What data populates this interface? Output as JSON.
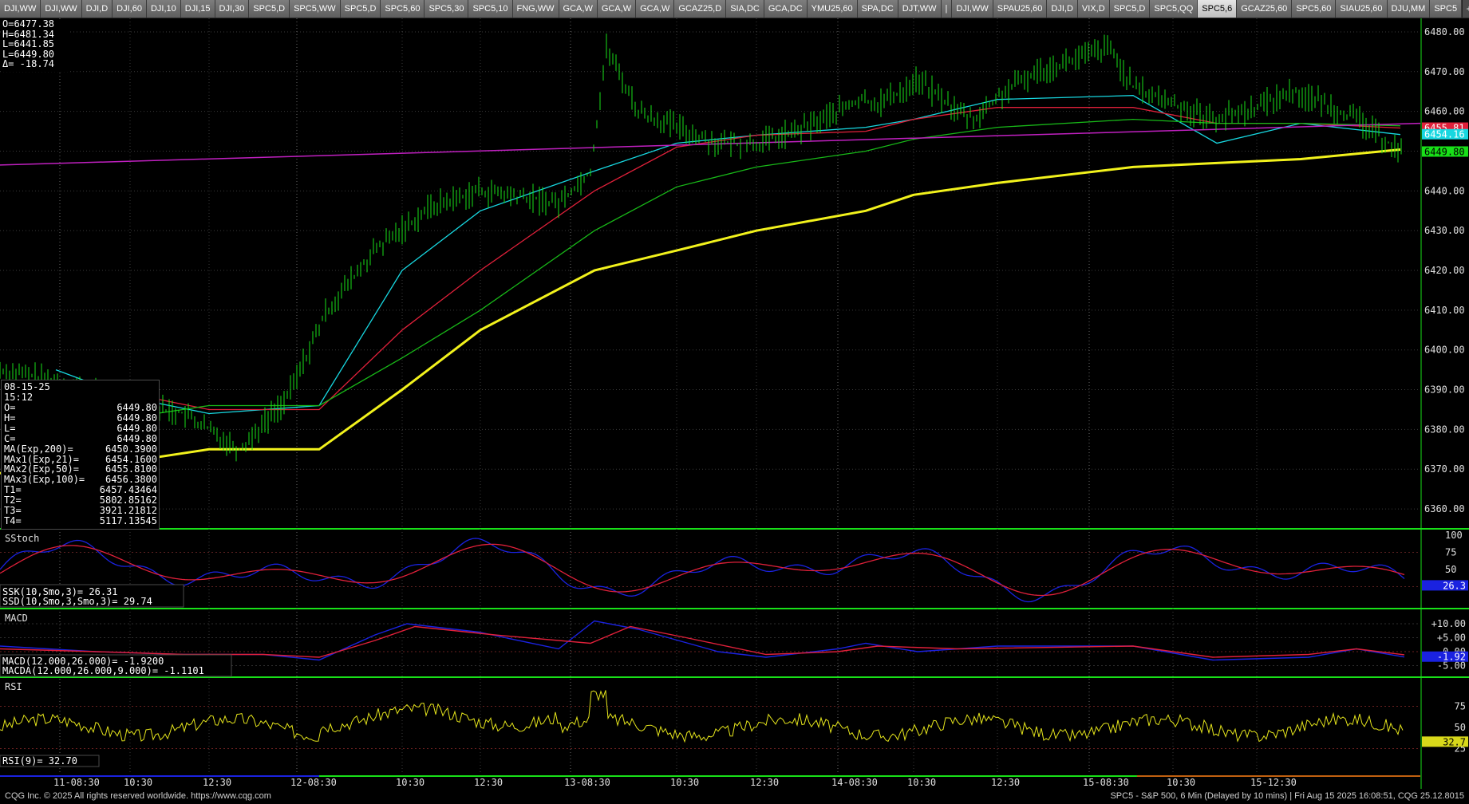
{
  "tabs": [
    "DJI,WW",
    "DJI,WW",
    "DJI,D",
    "DJI,60",
    "DJI,10",
    "DJI,15",
    "DJI,30",
    "SPC5,D",
    "SPC5,WW",
    "SPC5,D",
    "SPC5,60",
    "SPC5,30",
    "SPC5,10",
    "FNG,WW",
    "GCA,W",
    "GCA,W",
    "GCA,W",
    "GCAZ25,D",
    "SIA,DC",
    "GCA,DC",
    "YMU25,60",
    "SPA,DC",
    "DJT,WW",
    "|",
    "DJI,WW",
    "SPAU25,60",
    "DJI,D",
    "VIX,D",
    "SPC5,D",
    "SPC5,QQ",
    "SPC5,6",
    "GCAZ25,60",
    "SPC5,60",
    "SIAU25,60",
    "DJU,MM",
    "SPC5"
  ],
  "active_tab": "SPC5,6",
  "tab_buttons": {
    "add": "+",
    "scroll_left": "◂",
    "scroll_right": "▸"
  },
  "ohlc_box": {
    "lines": [
      "O=6477.38",
      "H=6481.34",
      "L=6441.85",
      "L=6449.80",
      "Δ= -18.74"
    ]
  },
  "data_window": {
    "date": "08-15-25",
    "time": "15:12",
    "rows": [
      {
        "label": "O=",
        "value": "6449.80"
      },
      {
        "label": "H=",
        "value": "6449.80"
      },
      {
        "label": "L=",
        "value": "6449.80"
      },
      {
        "label": "C=",
        "value": "6449.80"
      },
      {
        "label": "MA(Exp,200)=",
        "value": "6450.3900"
      },
      {
        "label": "MAx1(Exp,21)=",
        "value": "6454.1600"
      },
      {
        "label": "MAx2(Exp,50)=",
        "value": "6455.8100"
      },
      {
        "label": "MAx3(Exp,100)=",
        "value": "6456.3800"
      },
      {
        "label": "T1=",
        "value": "6457.43464"
      },
      {
        "label": "T2=",
        "value": "5802.85162"
      },
      {
        "label": "T3=",
        "value": "3921.21812"
      },
      {
        "label": "T4=",
        "value": "5117.13545"
      }
    ]
  },
  "price_axis": {
    "ticks": [
      "6480.00",
      "6470.00",
      "6460.00",
      "6450.00",
      "6440.00",
      "6430.00",
      "6420.00",
      "6410.00",
      "6400.00",
      "6390.00",
      "6380.00",
      "6370.00",
      "6360.00"
    ],
    "markers": [
      {
        "value": "6455.81",
        "color": "#e0203a"
      },
      {
        "value": "6454.16",
        "color": "#17d7e0"
      },
      {
        "value": "6449.80",
        "color": "#18e018"
      }
    ]
  },
  "stoch": {
    "title": "SStoch",
    "readouts": [
      "SSK(10,Smo,3)=        26.31",
      "SSD(10,Smo,3,Smo,3)=  29.74"
    ],
    "axis": [
      "100",
      "75",
      "50",
      "25"
    ],
    "marker": {
      "value": "26.3",
      "color": "#1a22e0"
    }
  },
  "macd": {
    "title": "MACD",
    "readouts": [
      "MACD(12.000,26.000)=       -1.9200",
      "MACDA(12.000,26.000,9.000)= -1.1101"
    ],
    "axis": [
      "+10.00",
      "+5.00",
      "0.00",
      "-5.00"
    ],
    "marker": {
      "value": "-1.92",
      "color": "#1a22e0"
    }
  },
  "rsi": {
    "title": "RSI",
    "readout": "RSI(9)=   32.70",
    "axis": [
      "75",
      "50",
      "25"
    ],
    "marker": {
      "value": "32.7",
      "color": "#d8d81a"
    }
  },
  "time_axis": [
    "11-08:30",
    "10:30",
    "12:30",
    "12-08:30",
    "10:30",
    "12:30",
    "13-08:30",
    "10:30",
    "12:30",
    "14-08:30",
    "10:30",
    "12:30",
    "15-08:30",
    "10:30",
    "15-12:30"
  ],
  "footer": {
    "left": "CQG Inc. © 2025 All rights reserved worldwide. https://www.cqg.com",
    "right": "SPC5 - S&P 500, 6 Min (Delayed by 10 mins) | Fri Aug 15 2025 16:08:51, CQG 25.12.8015"
  },
  "colors": {
    "price": "#19e019",
    "ema21": "#17d7e0",
    "ema50": "#e0203a",
    "ema100": "#18b818",
    "ema200": "#f2f21c",
    "trend": "#c020c0",
    "k": "#1a22e0",
    "d": "#e0203a",
    "rsi": "#e6e61c"
  },
  "chart_data": {
    "type": "line",
    "x": [
      "11-08:30",
      "11-10:30",
      "11-12:30",
      "12-08:30",
      "12-10:30",
      "12-12:30",
      "13-08:30",
      "13-10:30",
      "13-12:30",
      "14-08:30",
      "14-10:30",
      "14-12:30",
      "15-08:30",
      "15-10:30",
      "15-12:30",
      "15-15:12"
    ],
    "series": [
      {
        "name": "MA(Exp,200)",
        "values": [
          6370.5,
          6372,
          6375,
          6375,
          6390,
          6405,
          6420,
          6425,
          6430,
          6435,
          6439,
          6442,
          6446,
          6447,
          6448,
          6450.39
        ]
      },
      {
        "name": "MAx1(Exp,21)",
        "values": [
          6395,
          6388,
          6384,
          6386,
          6420,
          6435,
          6445,
          6452,
          6454,
          6456,
          6458,
          6463,
          6464,
          6452,
          6457,
          6454.16
        ]
      },
      {
        "name": "MAx2(Exp,50)",
        "values": [
          6391,
          6389,
          6385,
          6385,
          6405,
          6420,
          6440,
          6451,
          6454,
          6455,
          6458,
          6461,
          6461,
          6457,
          6457,
          6455.81
        ]
      },
      {
        "name": "MAx3(Exp,100)",
        "values": [
          6382,
          6383,
          6386,
          6386,
          6398,
          6410,
          6430,
          6441,
          6446,
          6450,
          6453,
          6456,
          6458,
          6457,
          6457,
          6456.38
        ]
      }
    ],
    "ylim": [
      6355,
      6483
    ]
  }
}
